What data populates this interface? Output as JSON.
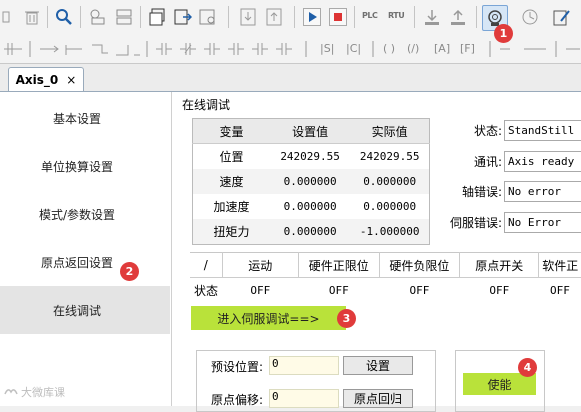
{
  "colors": {
    "accent_green": "#b9e23a",
    "callout_red": "#e03b3b",
    "active_nav": "#e4e4e4"
  },
  "toolbar1": {
    "icons": [
      "delete-icon",
      "search-icon",
      "link-icon",
      "unlink-icon",
      "new-window-icon",
      "export-icon",
      "monitor-icon",
      "download-icon",
      "upload-icon",
      "run-icon",
      "stop-icon",
      "plc-icon",
      "rtu-icon",
      "save-download-icon",
      "save-upload-icon",
      "axis-config-icon",
      "timer-icon",
      "edit-icon"
    ],
    "plc_label": "PLC",
    "rtu_label": "RTU"
  },
  "toolbar2": {
    "icons": [
      "ladder-icons"
    ],
    "s_label": "|S|",
    "c_label": "|C|",
    "paren_label": "( )",
    "paren_slash_label": "(/)",
    "a_label": "[A]",
    "f_label": "[F]"
  },
  "tab": {
    "label": "Axis_0",
    "close": "×"
  },
  "sidebar": {
    "items": [
      {
        "label": "基本设置"
      },
      {
        "label": "单位换算设置"
      },
      {
        "label": "模式/参数设置"
      },
      {
        "label": "原点返回设置"
      },
      {
        "label": "在线调试"
      }
    ]
  },
  "main": {
    "section_title": "在线调试",
    "var_table": {
      "headers": [
        "变量",
        "设置值",
        "实际值"
      ],
      "rows": [
        {
          "name": "位置",
          "set": "242029.55",
          "actual": "242029.55"
        },
        {
          "name": "速度",
          "set": "0.000000",
          "actual": "0.000000"
        },
        {
          "name": "加速度",
          "set": "0.000000",
          "actual": "0.000000"
        },
        {
          "name": "扭矩力",
          "set": "0.000000",
          "actual": "-1.000000"
        }
      ]
    },
    "status": [
      {
        "label": "状态:",
        "value": "StandStill"
      },
      {
        "label": "通讯:",
        "value": "Axis ready"
      },
      {
        "label": "轴错误:",
        "value": "No error"
      },
      {
        "label": "伺服错误:",
        "value": "No Error"
      }
    ],
    "io_table": {
      "headers": [
        "/",
        "运动",
        "硬件正限位",
        "硬件负限位",
        "原点开关",
        "软件正"
      ],
      "row": [
        "状态",
        "OFF",
        "OFF",
        "OFF",
        "OFF",
        "OFF"
      ]
    },
    "enter_servo_label": "进入伺服调试==>",
    "preset": {
      "position_label": "预设位置:",
      "position_value": "0",
      "set_button": "设置",
      "offset_label": "原点偏移:",
      "offset_value": "0",
      "home_button": "原点回归"
    },
    "enable_button": "使能"
  },
  "callouts": [
    "1",
    "2",
    "3",
    "4"
  ],
  "watermark": "大微库课"
}
